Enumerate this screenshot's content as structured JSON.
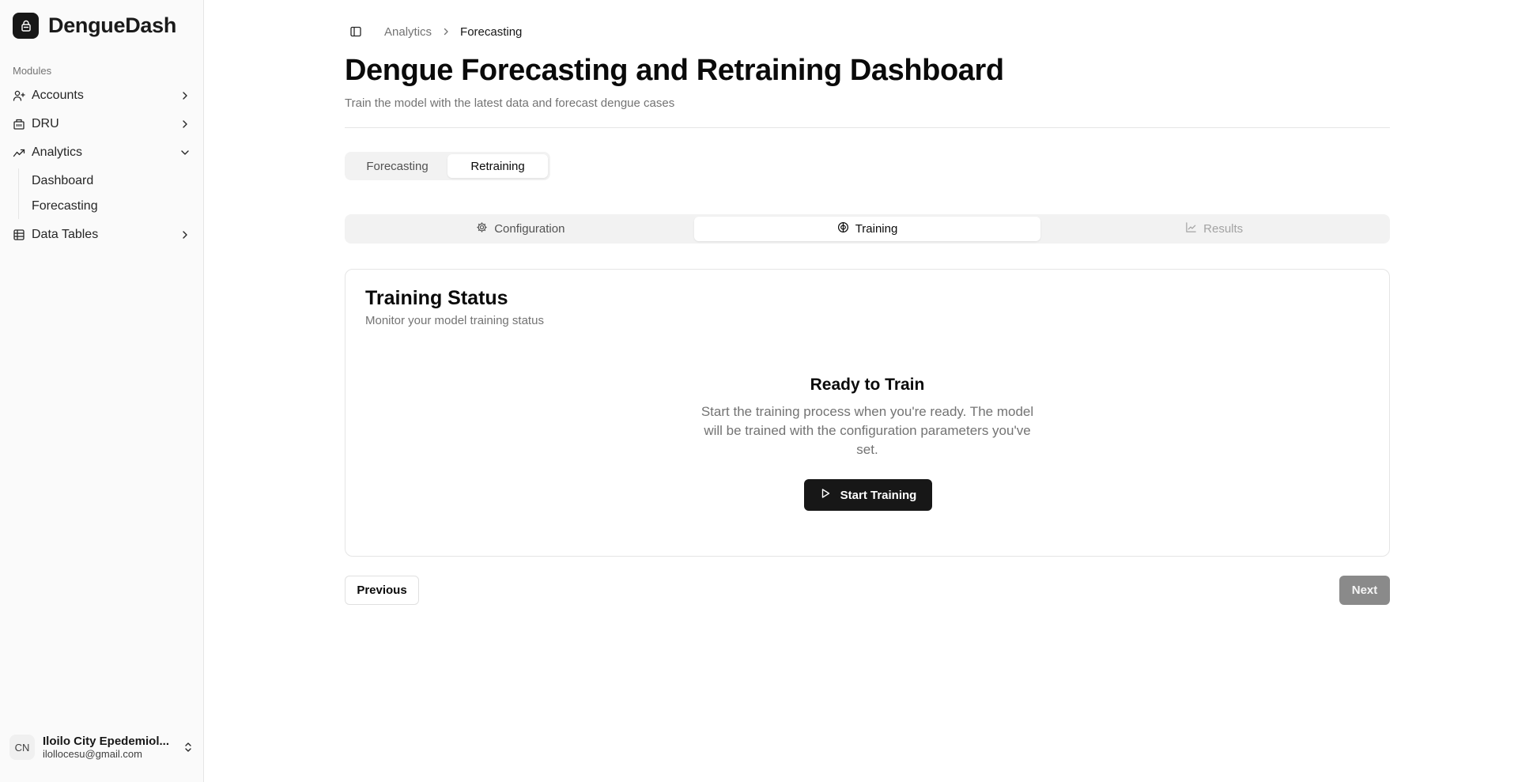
{
  "sidebar": {
    "brand": "DengueDash",
    "modules_label": "Modules",
    "items": [
      {
        "label": "Accounts",
        "icon": "user-plus-icon"
      },
      {
        "label": "DRU",
        "icon": "building-icon"
      },
      {
        "label": "Analytics",
        "icon": "chart-trend-icon",
        "expanded": true,
        "children": [
          {
            "label": "Dashboard"
          },
          {
            "label": "Forecasting"
          }
        ]
      },
      {
        "label": "Data Tables",
        "icon": "table-icon"
      }
    ],
    "user": {
      "initials": "CN",
      "name": "Iloilo City Epedemiol...",
      "email": "ilollocesu@gmail.com"
    }
  },
  "breadcrumb": {
    "parent": "Analytics",
    "current": "Forecasting"
  },
  "page": {
    "title": "Dengue Forecasting and Retraining Dashboard",
    "subtitle": "Train the model with the latest data and forecast dengue cases"
  },
  "mode_tabs": [
    {
      "label": "Forecasting",
      "active": false
    },
    {
      "label": "Retraining",
      "active": true
    }
  ],
  "step_tabs": [
    {
      "label": "Configuration",
      "icon": "gear-icon",
      "state": "normal"
    },
    {
      "label": "Training",
      "icon": "brain-icon",
      "state": "active"
    },
    {
      "label": "Results",
      "icon": "line-chart-icon",
      "state": "disabled"
    }
  ],
  "card": {
    "title": "Training Status",
    "subtitle": "Monitor your model training status",
    "ready_title": "Ready to Train",
    "ready_desc_line1": "Start the training process when you're ready. The model",
    "ready_desc_line2": "will be trained with the configuration parameters you've",
    "ready_desc_line3": "set.",
    "start_button": "Start Training"
  },
  "footer": {
    "previous": "Previous",
    "next": "Next"
  },
  "colors": {
    "primary": "#171717",
    "muted_text": "#737373",
    "disabled_button": "#8a8a8a",
    "sidebar_bg": "#fafafa"
  }
}
